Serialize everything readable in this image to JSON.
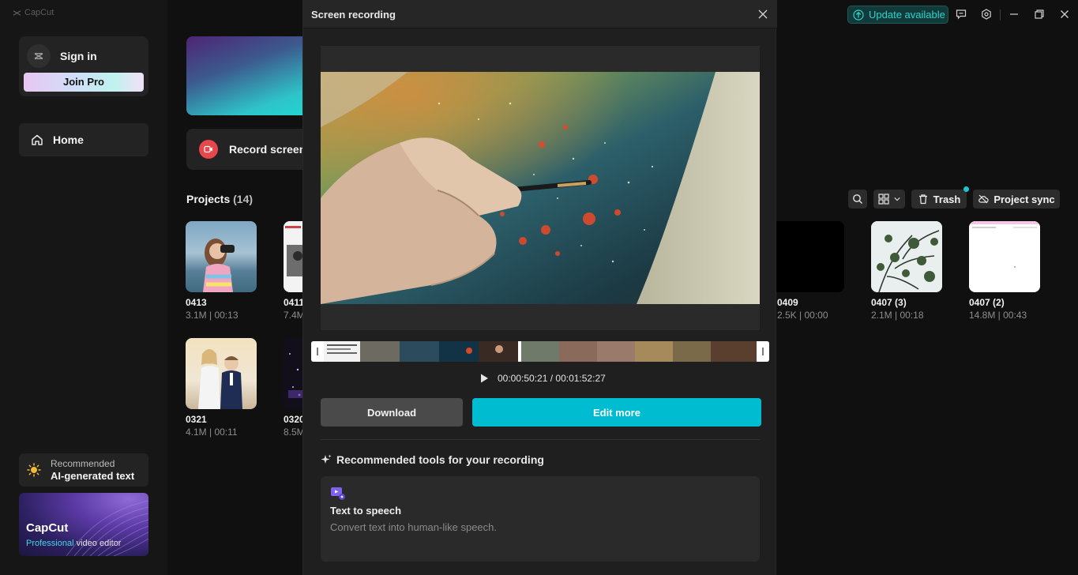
{
  "app": {
    "brand": "CapCut"
  },
  "sidebar": {
    "sign_in": "Sign in",
    "join_pro": "Join Pro",
    "home": "Home",
    "recommended_small": "Recommended",
    "recommended_big": "AI-generated text",
    "promo_title": "CapCut",
    "promo_sub_accent": "Professional",
    "promo_sub_rest": " video editor"
  },
  "main": {
    "record_screen": "Record screen",
    "projects_label": "Projects",
    "projects_count": "(14)",
    "trash": "Trash",
    "project_sync": "Project sync",
    "projects": [
      {
        "name": "0413",
        "meta": "3.1M | 00:13"
      },
      {
        "name": "0411",
        "meta": "7.4M"
      },
      {
        "name": "0409",
        "meta": "2.5K | 00:00"
      },
      {
        "name": "0407 (3)",
        "meta": "2.1M | 00:18"
      },
      {
        "name": "0407 (2)",
        "meta": "14.8M | 00:43"
      },
      {
        "name": "0321",
        "meta": "4.1M | 00:11"
      },
      {
        "name": "0320",
        "meta": "8.5M"
      }
    ]
  },
  "titlebar": {
    "update": "Update available"
  },
  "modal": {
    "title": "Screen recording",
    "timecode": "00:00:50:21 / 00:01:52:27",
    "download": "Download",
    "edit_more": "Edit more",
    "recommended_tools_title": "Recommended tools for your recording",
    "tool_name": "Text to speech",
    "tool_desc": "Convert text into human-like speech."
  },
  "colors": {
    "accent": "#00bcd0",
    "update": "#2bd4c9",
    "record": "#e8474c"
  }
}
